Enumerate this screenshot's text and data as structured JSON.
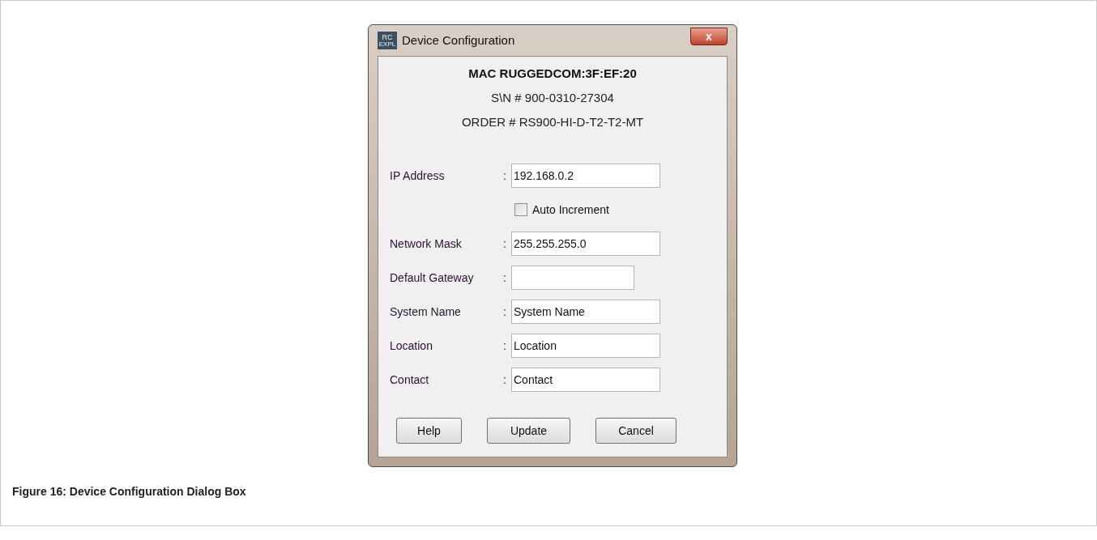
{
  "window": {
    "title": "Device Configuration",
    "app_icon": [
      "RC",
      "EXPL"
    ],
    "close": "x"
  },
  "header": [
    "MAC RUGGEDCOM:3F:EF:20",
    "S\\N # 900-0310-27304",
    "ORDER # RS900-HI-D-T2-T2-MT"
  ],
  "form": [
    {
      "kind": "field",
      "label": "IP Address",
      "value": "192.168.0.2"
    },
    {
      "kind": "checkbox",
      "label": "Auto Increment",
      "checked": false
    },
    {
      "kind": "field",
      "label": "Network Mask",
      "value": "255.255.255.0"
    },
    {
      "kind": "short-field",
      "label": "Default Gateway"
    },
    {
      "kind": "field",
      "label": "System Name",
      "value": "System Name"
    },
    {
      "kind": "field",
      "label": "Location",
      "value": "Location"
    },
    {
      "kind": "field",
      "label": "Contact",
      "value": "Contact"
    }
  ],
  "colon": ":",
  "buttons": [
    "Help",
    "Update",
    "Cancel"
  ],
  "caption": "Figure 16: Device Configuration Dialog Box"
}
